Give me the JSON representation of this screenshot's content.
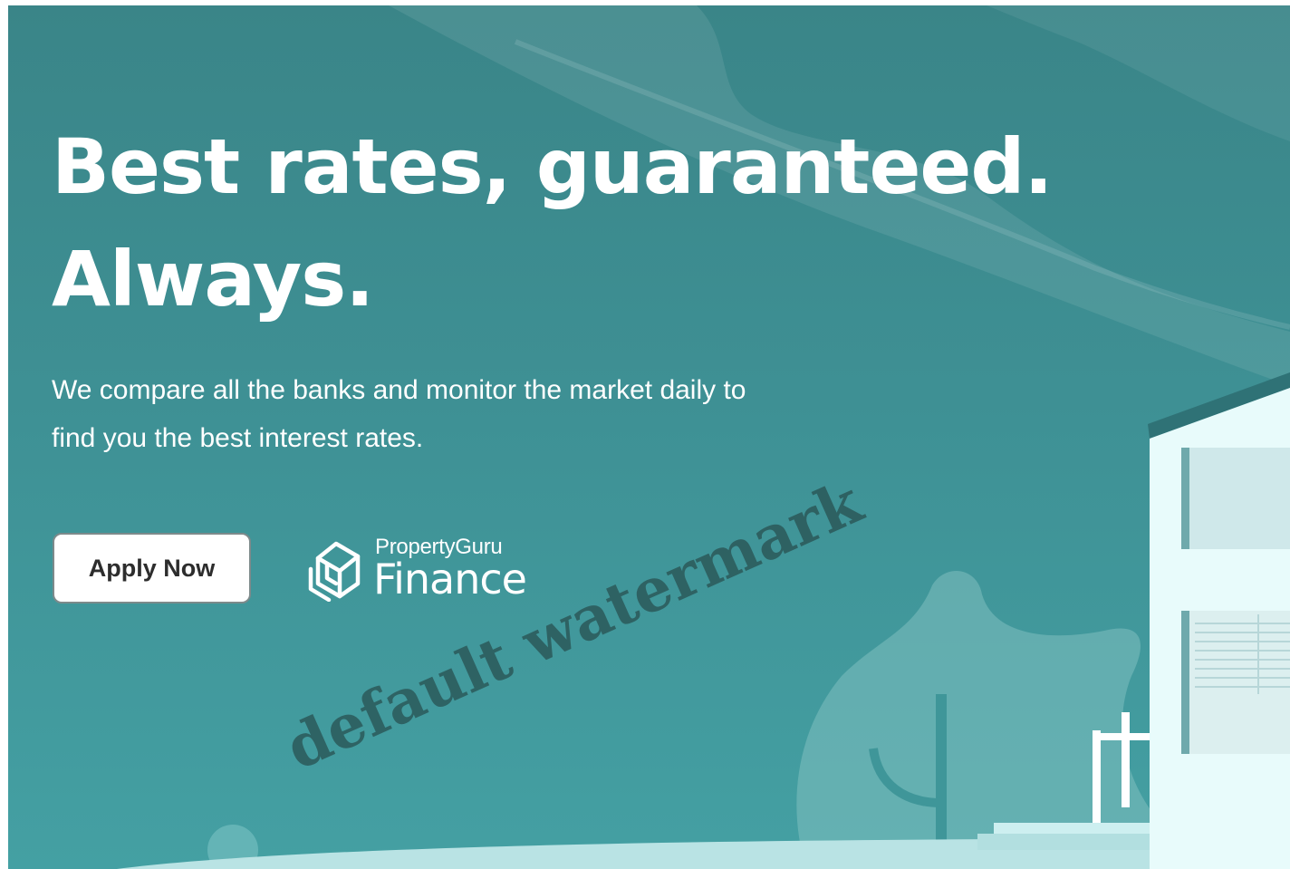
{
  "hero": {
    "headline_line1": "Best rates, guaranteed.",
    "headline_line2": "Always.",
    "subtext_line1": "We compare all the banks and monitor the market daily to",
    "subtext_line2": "find you the best interest rates."
  },
  "cta": {
    "apply_label": "Apply Now"
  },
  "logo": {
    "brand_small": "PropertyGuru",
    "brand_big": "Finance",
    "icon": "propertyguru-house-logo-icon"
  },
  "watermark": {
    "text": "default watermark"
  },
  "colors": {
    "background_top": "#3a8588",
    "background_bottom": "#44a0a3",
    "headline": "#ffffff",
    "button_bg": "#ffffff",
    "button_text": "#2d2d2d",
    "house_wall": "#e8fbfb"
  }
}
